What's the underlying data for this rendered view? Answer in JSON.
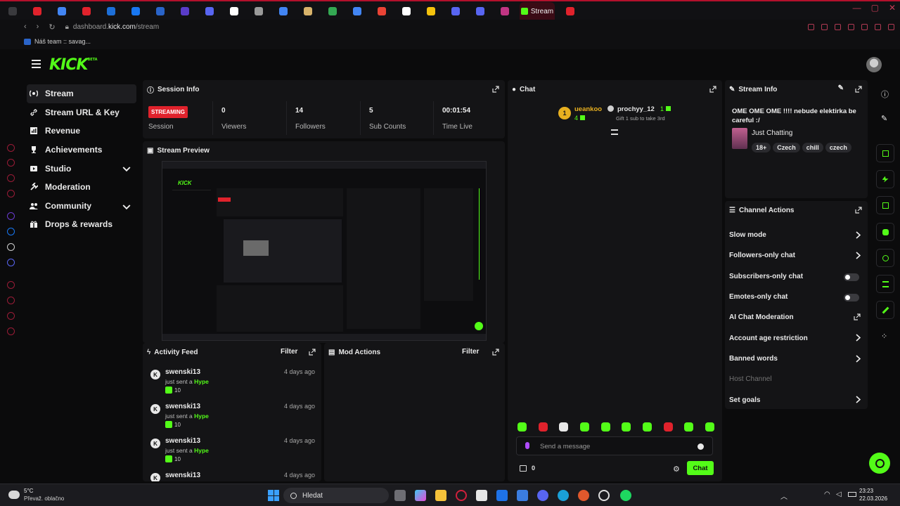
{
  "browser": {
    "active_tab_label": "Stream",
    "url_host": "dashboard.",
    "url_domain": "kick.com",
    "url_path": "/stream",
    "bookmark_label": "Náš team :: savag...",
    "tab_colors": [
      "#3a3a3e",
      "#e0222c",
      "#4285f4",
      "#e0222c",
      "#1d6fd8",
      "#1877f2",
      "#2a64c9",
      "#5a3cc9",
      "#5865f2",
      "#ffffff",
      "#9a9a9a",
      "#4285f4",
      "#d8b36b",
      "#34a853",
      "#4285f4",
      "#ea4335",
      "#ffffff",
      "#f4c20d",
      "#5865f2",
      "#5865f2",
      "#c13584",
      "#e0222c"
    ]
  },
  "kick": {
    "logo_text": "KICK",
    "logo_badge": "BETA"
  },
  "nav": {
    "items": [
      {
        "label": "Stream",
        "icon": "broadcast-icon",
        "active": true,
        "chevron": false
      },
      {
        "label": "Stream URL & Key",
        "icon": "link-icon",
        "active": false,
        "chevron": false
      },
      {
        "label": "Revenue",
        "icon": "chart-icon",
        "active": false,
        "chevron": false
      },
      {
        "label": "Achievements",
        "icon": "trophy-icon",
        "active": false,
        "chevron": false
      },
      {
        "label": "Studio",
        "icon": "studio-icon",
        "active": false,
        "chevron": true
      },
      {
        "label": "Moderation",
        "icon": "gavel-icon",
        "active": false,
        "chevron": false
      },
      {
        "label": "Community",
        "icon": "community-icon",
        "active": false,
        "chevron": true
      },
      {
        "label": "Drops & rewards",
        "icon": "gift-icon",
        "active": false,
        "chevron": false
      }
    ]
  },
  "session": {
    "title": "Session Info",
    "status_badge": "STREAMING",
    "stats": [
      {
        "value": "",
        "label": "Session"
      },
      {
        "value": "0",
        "label": "Viewers"
      },
      {
        "value": "14",
        "label": "Followers"
      },
      {
        "value": "5",
        "label": "Sub Counts"
      },
      {
        "value": "00:01:54",
        "label": "Time Live"
      }
    ]
  },
  "preview": {
    "title": "Stream Preview"
  },
  "activity": {
    "title": "Activity Feed",
    "filter_label": "Filter",
    "items": [
      {
        "avatar": "K",
        "name": "swenski13",
        "time": "4 days ago",
        "text": "just sent a",
        "highlight": "Hype",
        "amount": "10"
      },
      {
        "avatar": "K",
        "name": "swenski13",
        "time": "4 days ago",
        "text": "just sent a",
        "highlight": "Hype",
        "amount": "10"
      },
      {
        "avatar": "K",
        "name": "swenski13",
        "time": "4 days ago",
        "text": "just sent a",
        "highlight": "Hype",
        "amount": "10"
      },
      {
        "avatar": "K",
        "name": "swenski13",
        "time": "4 days ago",
        "text": "",
        "highlight": "",
        "amount": ""
      }
    ]
  },
  "modactions": {
    "title": "Mod Actions",
    "filter_label": "Filter"
  },
  "chat": {
    "title": "Chat",
    "pinned": {
      "rank": "1",
      "user": "ueankoo",
      "count": "4",
      "gifter": "prochyy_12",
      "gift_count": "1",
      "gift_text": "Gift 1 sub to take 3rd"
    },
    "placeholder": "Send a message",
    "kick_count": "0",
    "send_label": "Chat",
    "emote_colors": [
      "#53fc18",
      "#e0222c",
      "#e8e8e8",
      "#53fc18",
      "#53fc18",
      "#53fc18",
      "#53fc18",
      "#e0222c",
      "#53fc18",
      "#53fc18"
    ]
  },
  "streaminfo": {
    "title": "Stream Info",
    "stream_title": "OME OME OME !!!! nebude elektirka be careful :/",
    "category": "Just Chatting",
    "tags": [
      "18+",
      "Czech",
      "chill",
      "czech"
    ]
  },
  "channelactions": {
    "title": "Channel Actions",
    "items": [
      {
        "label": "Slow mode",
        "control": "chevron"
      },
      {
        "label": "Followers-only chat",
        "control": "chevron"
      },
      {
        "label": "Subscribers-only chat",
        "control": "toggle"
      },
      {
        "label": "Emotes-only chat",
        "control": "toggle"
      },
      {
        "label": "AI Chat Moderation",
        "control": "external"
      },
      {
        "label": "Account age restriction",
        "control": "chevron"
      },
      {
        "label": "Banned words",
        "control": "chevron"
      },
      {
        "label": "Host Channel",
        "control": "disabled"
      },
      {
        "label": "Set goals",
        "control": "chevron"
      }
    ]
  },
  "taskbar": {
    "weather_temp": "5°C",
    "weather_text": "Převaž. oblačno",
    "search_label": "Hledat",
    "time": "23:23",
    "date": "22.03.2026"
  }
}
